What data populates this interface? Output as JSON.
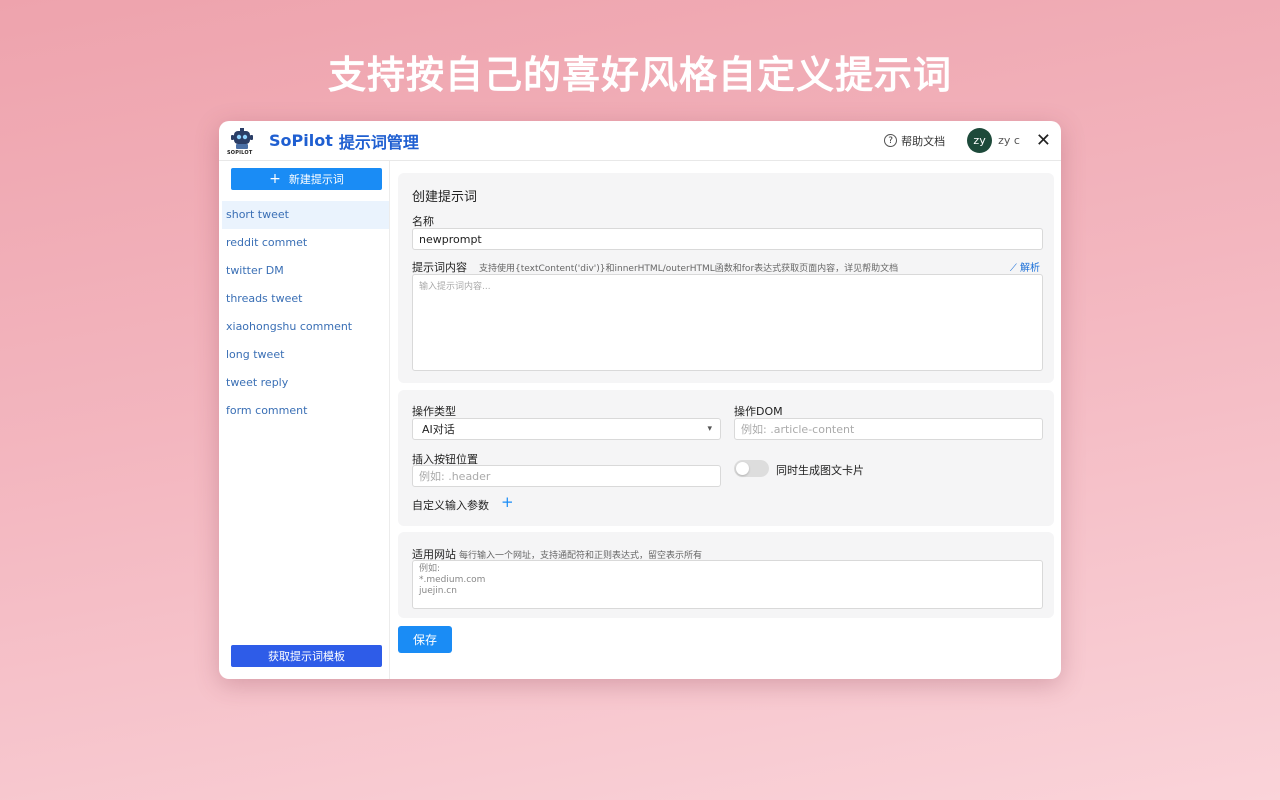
{
  "hero": {
    "title": "支持按自己的喜好风格自定义提示词"
  },
  "header": {
    "brand": "SoPilot",
    "subtitle": "提示词管理",
    "logo_text": "SOPILOT",
    "help_label": "帮助文档",
    "avatar_initials": "zy",
    "username": "zy c"
  },
  "sidebar": {
    "new_button": "新建提示词",
    "items": [
      {
        "label": "short tweet"
      },
      {
        "label": "reddit commet"
      },
      {
        "label": "twitter DM"
      },
      {
        "label": "threads tweet"
      },
      {
        "label": "xiaohongshu comment"
      },
      {
        "label": "long tweet"
      },
      {
        "label": "tweet reply"
      },
      {
        "label": "form comment"
      }
    ],
    "template_button": "获取提示词模板"
  },
  "form": {
    "title": "创建提示词",
    "name_label": "名称",
    "name_value": "newprompt",
    "content_label": "提示词内容",
    "content_hint": "支持使用{textContent('div')}和innerHTML/outerHTML函数和for表达式获取页面内容，详见帮助文档",
    "parse_label": "解析",
    "content_placeholder": "输入提示词内容...",
    "op_type_label": "操作类型",
    "op_type_value": "AI对话",
    "op_dom_label": "操作DOM",
    "op_dom_placeholder": "例如: .article-content",
    "insert_pos_label": "插入按钮位置",
    "insert_pos_placeholder": "例如: .header",
    "card_toggle_label": "同时生成图文卡片",
    "card_toggle_on": false,
    "custom_params_label": "自定义输入参数",
    "sites_label": "适用网站",
    "sites_hint": "每行输入一个网址，支持通配符和正则表达式，留空表示所有",
    "sites_placeholder": "例如:\n*.medium.com\njuejin.cn",
    "save_button": "保存"
  },
  "colors": {
    "accent": "#1a8cf5",
    "brand": "#1f5fd1",
    "template_button": "#2e5ce8"
  }
}
